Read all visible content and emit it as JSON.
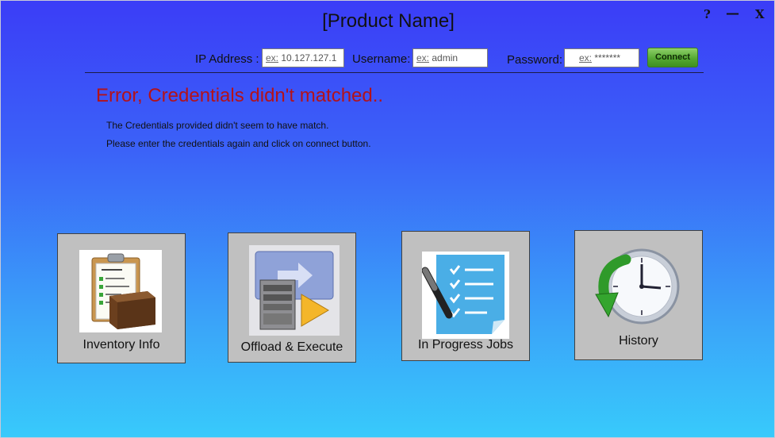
{
  "window": {
    "title": "[Product Name]",
    "controls": {
      "help": "?",
      "minimize": "—",
      "close": "X"
    }
  },
  "connection": {
    "ip_label": "IP Address :",
    "ip_example_prefix": "ex:",
    "ip_example": "10.127.127.1",
    "username_label": "Username:",
    "username_example_prefix": "ex:",
    "username_example": "admin",
    "password_label": "Password:",
    "password_example_prefix": "ex:",
    "password_example": "*******",
    "connect_label": "Connect"
  },
  "error": {
    "title": "Error, Credentials didn't matched..",
    "line1": "The Credentials provided didn't seem to have match.",
    "line2": "Please enter the credentials again and click on connect button."
  },
  "tiles": [
    {
      "label": "Inventory Info",
      "icon": "inventory-clipboard-box-icon"
    },
    {
      "label": "Offload & Execute",
      "icon": "server-arrow-icon"
    },
    {
      "label": "In Progress Jobs",
      "icon": "checklist-pen-icon"
    },
    {
      "label": "History",
      "icon": "clock-arrow-icon"
    }
  ],
  "colors": {
    "error_text": "#b3121a",
    "connect_button": "#55a933",
    "background_top": "#3b3df7",
    "background_bottom": "#38cafb",
    "tile_background": "#c0c0c0"
  }
}
